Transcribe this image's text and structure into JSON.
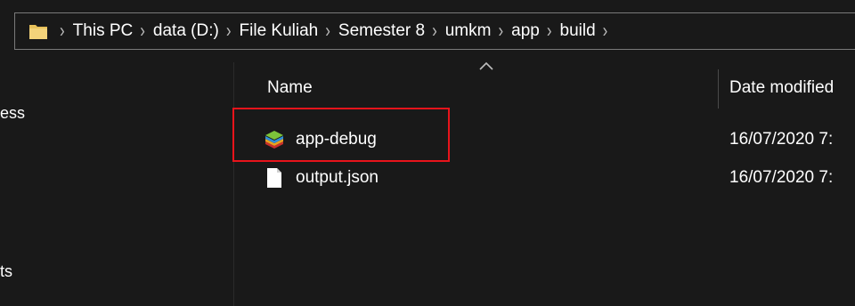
{
  "address_bar": {
    "icon": "folder-icon",
    "crumbs": [
      "This PC",
      "data (D:)",
      "File Kuliah",
      "Semester 8",
      "umkm",
      "app",
      "build"
    ],
    "separator": "›"
  },
  "nav_pane": {
    "items": [
      "ess",
      "ts"
    ]
  },
  "file_list": {
    "columns": {
      "name": "Name",
      "date_modified": "Date modified"
    },
    "sort": "ascending",
    "files": [
      {
        "name": "app-debug",
        "date": "16/07/2020 7:",
        "icon": "bluestacks-apk-icon",
        "highlighted": true
      },
      {
        "name": "output.json",
        "date": "16/07/2020 7:",
        "icon": "file-icon",
        "highlighted": false
      }
    ]
  },
  "colors": {
    "background": "#191919",
    "highlight_border": "#e8141b",
    "folder": "#e8c15a"
  }
}
